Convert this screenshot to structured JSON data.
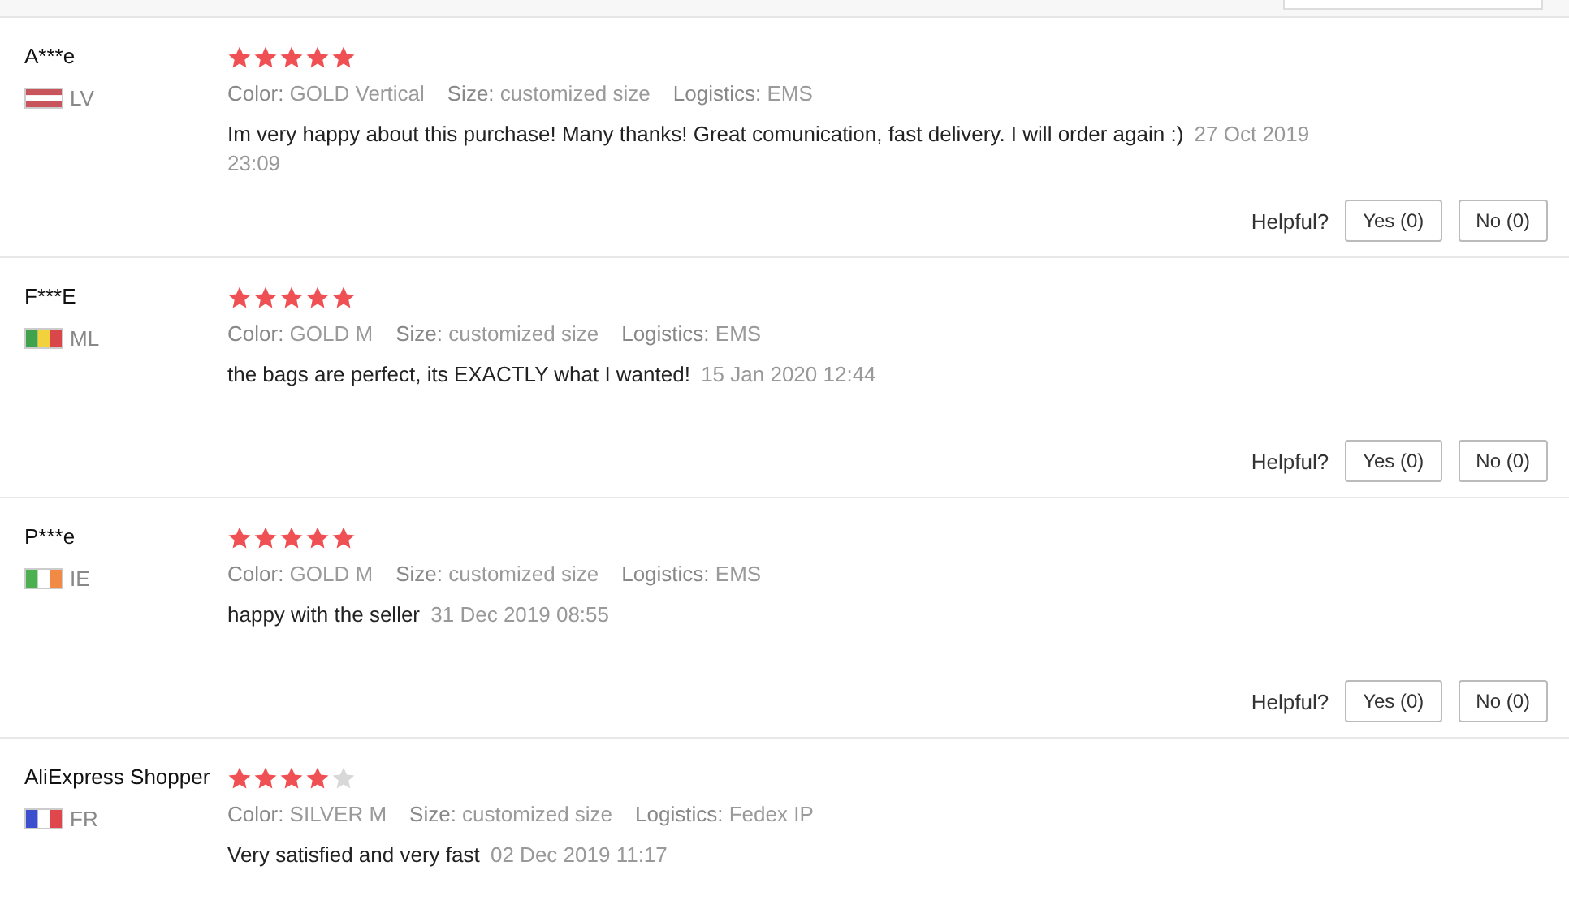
{
  "reviews": [
    {
      "name": "A***e",
      "country": "LV",
      "flag": {
        "kind": "horizontal",
        "stripes": [
          {
            "color": "#c8555b"
          },
          {
            "color": "#ffffff"
          },
          {
            "color": "#c8555b"
          }
        ]
      },
      "stars": 5,
      "attributes": [
        {
          "label": "Color:",
          "value": "GOLD Vertical"
        },
        {
          "label": "Size:",
          "value": "customized size"
        },
        {
          "label": "Logistics:",
          "value": "EMS"
        }
      ],
      "comment": "Im very happy about this purchase! Many thanks! Great comunication, fast delivery. I will order again :)",
      "date": "27 Oct 2019 23:09",
      "helpful": {
        "label": "Helpful?",
        "yes": "Yes (0)",
        "no": "No (0)"
      }
    },
    {
      "name": "F***E",
      "country": "ML",
      "flag": {
        "kind": "vertical",
        "stripes": [
          {
            "color": "#3fa34d"
          },
          {
            "color": "#f2d23c"
          },
          {
            "color": "#d9474b"
          }
        ]
      },
      "stars": 5,
      "attributes": [
        {
          "label": "Color:",
          "value": "GOLD M"
        },
        {
          "label": "Size:",
          "value": "customized size"
        },
        {
          "label": "Logistics:",
          "value": "EMS"
        }
      ],
      "comment": "the bags are perfect, its EXACTLY what I wanted!",
      "date": "15 Jan 2020 12:44",
      "helpful": {
        "label": "Helpful?",
        "yes": "Yes (0)",
        "no": "No (0)"
      }
    },
    {
      "name": "P***e",
      "country": "IE",
      "flag": {
        "kind": "vertical",
        "stripes": [
          {
            "color": "#4caf50"
          },
          {
            "color": "#ffffff"
          },
          {
            "color": "#f08a45"
          }
        ]
      },
      "stars": 5,
      "attributes": [
        {
          "label": "Color:",
          "value": "GOLD M"
        },
        {
          "label": "Size:",
          "value": "customized size"
        },
        {
          "label": "Logistics:",
          "value": "EMS"
        }
      ],
      "comment": "happy with the seller",
      "date": "31 Dec 2019 08:55",
      "helpful": {
        "label": "Helpful?",
        "yes": "Yes (0)",
        "no": "No (0)"
      }
    },
    {
      "name": "AliExpress Shopper",
      "country": "FR",
      "flag": {
        "kind": "vertical",
        "stripes": [
          {
            "color": "#3b4fcf"
          },
          {
            "color": "#ffffff"
          },
          {
            "color": "#e0474c"
          }
        ]
      },
      "stars": 4,
      "attributes": [
        {
          "label": "Color:",
          "value": "SILVER M"
        },
        {
          "label": "Size:",
          "value": "customized size"
        },
        {
          "label": "Logistics:",
          "value": "Fedex IP"
        }
      ],
      "comment": "Very satisfied and very fast",
      "date": "02 Dec 2019 11:17"
    }
  ]
}
